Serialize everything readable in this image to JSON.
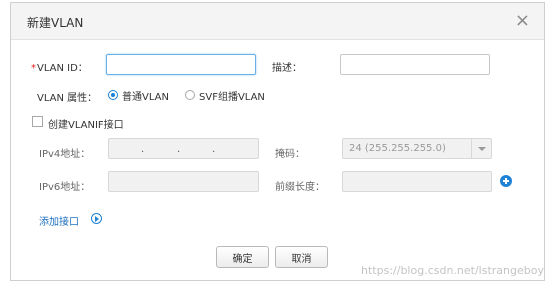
{
  "dialog": {
    "title": "新建VLAN",
    "close_glyph": "×"
  },
  "form": {
    "vlan_id": {
      "required_mark": "*",
      "label": "VLAN ID：",
      "value": ""
    },
    "description": {
      "label": "描述：",
      "value": ""
    },
    "vlan_attr": {
      "label": "VLAN 属性：",
      "options": [
        "普通VLAN",
        "SVF组播VLAN"
      ],
      "selected": "普通VLAN"
    },
    "create_vlanif": {
      "label": "创建VLANIF接口",
      "checked": false
    },
    "ipv4": {
      "label": "IPv4地址：",
      "dots": ".  .  ."
    },
    "mask": {
      "label": "掩码：",
      "value": "24 (255.255.255.0)"
    },
    "ipv6": {
      "label": "IPv6地址：",
      "value": ""
    },
    "prefix_length": {
      "label": "前缀长度：",
      "value": ""
    }
  },
  "add_interface": {
    "label": "添加接口"
  },
  "buttons": {
    "confirm": "确定",
    "cancel": "取消"
  },
  "watermark": "https://blog.csdn.net/lstrangeboy"
}
